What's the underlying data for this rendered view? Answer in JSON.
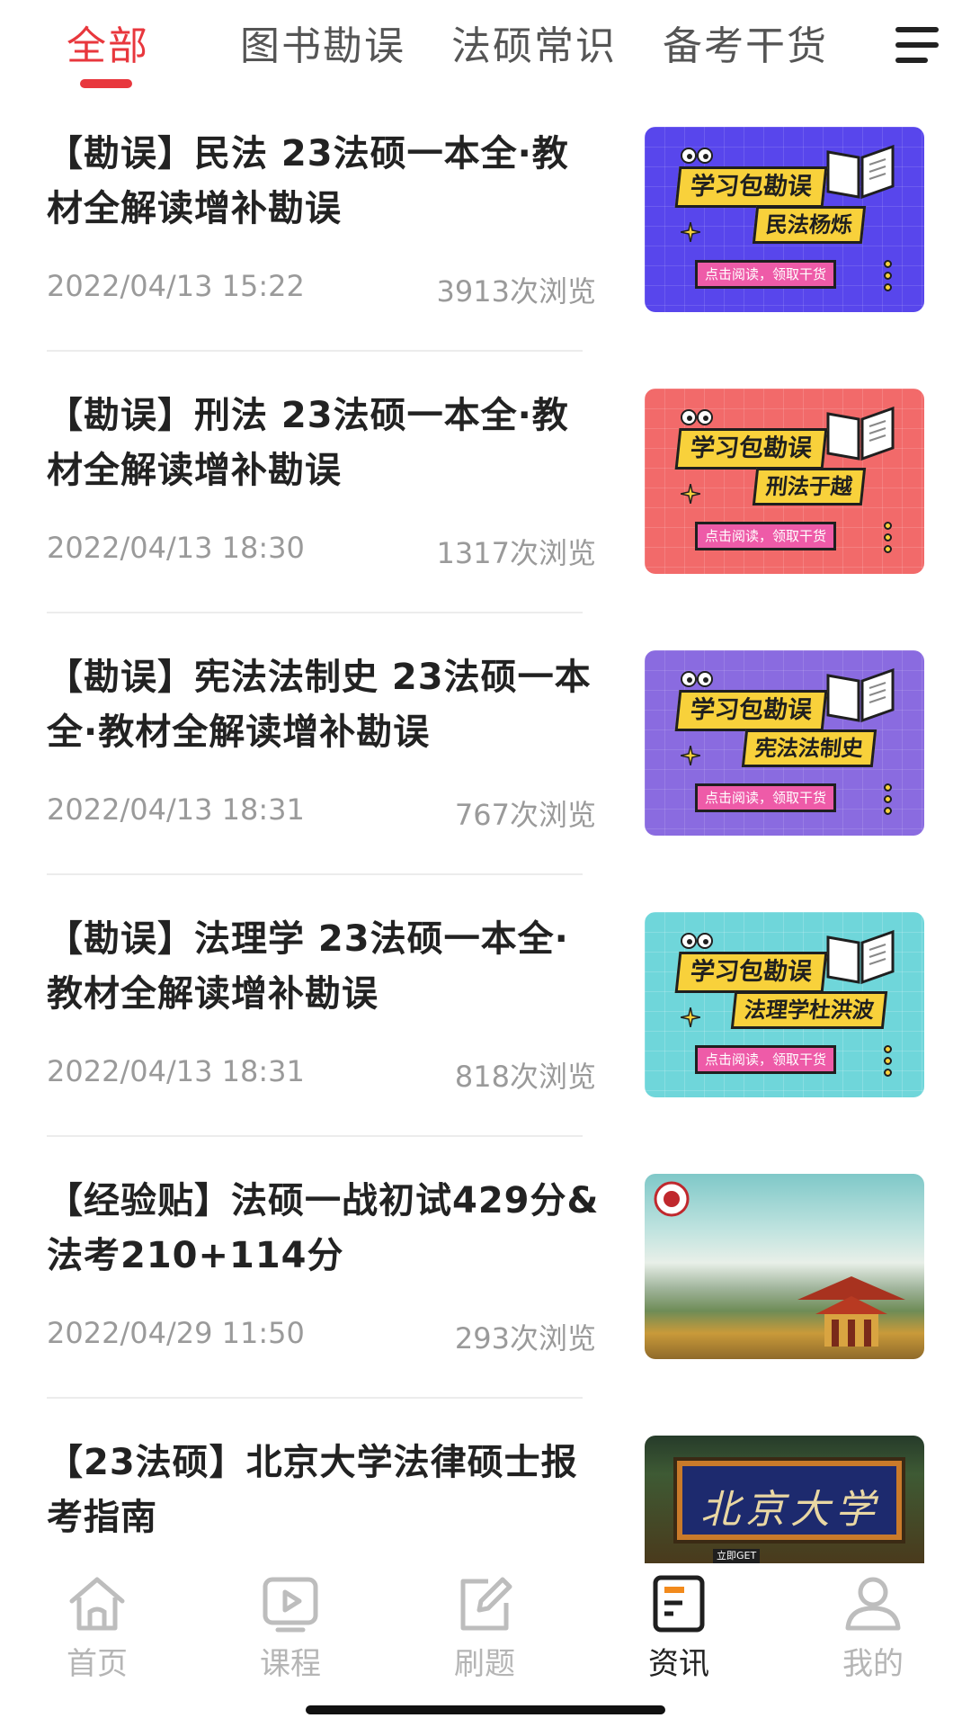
{
  "tabs": [
    {
      "label": "全部",
      "active": true
    },
    {
      "label": "图书勘误",
      "active": false
    },
    {
      "label": "法硕常识",
      "active": false
    },
    {
      "label": "备考干货",
      "active": false
    }
  ],
  "colors": {
    "accent": "#e8373d"
  },
  "articles": [
    {
      "title": "【勘误】民法 23法硕一本全·教材全解读增补勘误",
      "date": "2022/04/13 15:22",
      "views": "3913次浏览",
      "thumb": {
        "kind": "banner",
        "bg": "#5846ec",
        "line1": "学习包勘误",
        "line2": "民法杨烁",
        "cta": "点击阅读，领取干货"
      }
    },
    {
      "title": "【勘误】刑法 23法硕一本全·教材全解读增补勘误",
      "date": "2022/04/13 18:30",
      "views": "1317次浏览",
      "thumb": {
        "kind": "banner",
        "bg": "#f26a6a",
        "line1": "学习包勘误",
        "line2": "刑法于越",
        "cta": "点击阅读，领取干货"
      }
    },
    {
      "title": "【勘误】宪法法制史 23法硕一本全·教材全解读增补勘误",
      "date": "2022/04/13 18:31",
      "views": "767次浏览",
      "thumb": {
        "kind": "banner",
        "bg": "#8a6be0",
        "line1": "学习包勘误",
        "line2": "宪法法制史",
        "cta": "点击阅读，领取干货"
      }
    },
    {
      "title": "【勘误】法理学 23法硕一本全·教材全解读增补勘误",
      "date": "2022/04/13 18:31",
      "views": "818次浏览",
      "thumb": {
        "kind": "banner",
        "bg": "#6fd6da",
        "line1": "学习包勘误",
        "line2": "法理学杜洪波",
        "cta": "点击阅读，领取干货"
      }
    },
    {
      "title": "【经验贴】法硕一战初试429分&法考210+114分",
      "date": "2022/04/29 11:50",
      "views": "293次浏览",
      "thumb": {
        "kind": "photo-campus"
      }
    },
    {
      "title": "【23法硕】北京大学法律硕士报考指南",
      "date": "",
      "views": "",
      "thumb": {
        "kind": "photo-sign",
        "sign": "北京大学",
        "small": "立即GET"
      }
    }
  ],
  "nav": [
    {
      "label": "首页",
      "icon": "home-icon",
      "active": false
    },
    {
      "label": "课程",
      "icon": "course-play-icon",
      "active": false
    },
    {
      "label": "刷题",
      "icon": "edit-icon",
      "active": false
    },
    {
      "label": "资讯",
      "icon": "news-icon",
      "active": true
    },
    {
      "label": "我的",
      "icon": "profile-icon",
      "active": false
    }
  ]
}
